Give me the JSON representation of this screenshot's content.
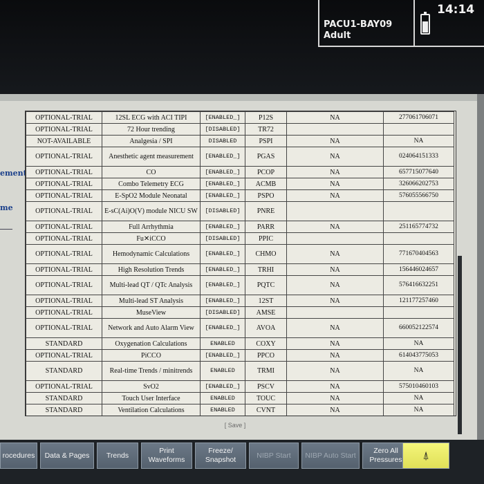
{
  "header": {
    "bed_label": "PACU1-BAY09",
    "patient_category": "Adult",
    "clock": "14:14",
    "battery_icon": "battery-icon"
  },
  "left_fragments": [
    "ement",
    "me"
  ],
  "options_table": {
    "rows": [
      [
        "OPTIONAL-TRIAL",
        "12SL ECG with ACI TIPI",
        "[ENABLED_]",
        "P12S",
        "NA",
        "277061706071"
      ],
      [
        "OPTIONAL-TRIAL",
        "72 Hour trending",
        "[DISABLED]",
        "TR72",
        "",
        ""
      ],
      [
        "NOT-AVAILABLE",
        "Analgesia / SPI",
        "DISABLED",
        "PSPI",
        "NA",
        "NA"
      ],
      [
        "OPTIONAL-TRIAL",
        "Anesthetic agent measurement",
        "[ENABLED_]",
        "PGAS",
        "NA",
        "024064151333"
      ],
      [
        "OPTIONAL-TRIAL",
        "CO",
        "[ENABLED_]",
        "PCOP",
        "NA",
        "657715077640"
      ],
      [
        "OPTIONAL-TRIAL",
        "Combo Telemetry ECG",
        "[ENABLED_]",
        "ACMB",
        "NA",
        "326066202753"
      ],
      [
        "OPTIONAL-TRIAL",
        "E-SpO2 Module Neonatal",
        "[ENABLED_]",
        "PSPO",
        "NA",
        "576055566750"
      ],
      [
        "OPTIONAL-TRIAL",
        "E-sC(Ai)O(V) module NICU SW",
        "[DISABLED]",
        "PNRE",
        "",
        ""
      ],
      [
        "OPTIONAL-TRIAL",
        "Full Arrhythmia",
        "[ENABLED_]",
        "PARR",
        "NA",
        "251165774732"
      ],
      [
        "OPTIONAL-TRIAL",
        "Fu✕iCCO",
        "[DISABLED]",
        "PPIC",
        "",
        ""
      ],
      [
        "OPTIONAL-TRIAL",
        "Hemodynamic Calculations",
        "[ENABLED_]",
        "CHMO",
        "NA",
        "771670404563"
      ],
      [
        "OPTIONAL-TRIAL",
        "High Resolution Trends",
        "[ENABLED_]",
        "TRHI",
        "NA",
        "156446024657"
      ],
      [
        "OPTIONAL-TRIAL",
        "Multi-lead QT / QTc Analysis",
        "[ENABLED_]",
        "PQTC",
        "NA",
        "576416632251"
      ],
      [
        "OPTIONAL-TRIAL",
        "Multi-lead ST Analysis",
        "[ENABLED_]",
        "12ST",
        "NA",
        "121177257460"
      ],
      [
        "OPTIONAL-TRIAL",
        "MuseView",
        "[DISABLED]",
        "AMSE",
        "",
        ""
      ],
      [
        "OPTIONAL-TRIAL",
        "Network and Auto Alarm View",
        "[ENABLED_]",
        "AVOA",
        "NA",
        "660052122574"
      ],
      [
        "STANDARD",
        "Oxygenation Calculations",
        "ENABLED",
        "COXY",
        "NA",
        "NA"
      ],
      [
        "OPTIONAL-TRIAL",
        "PiCCO",
        "[ENABLED_]",
        "PPCO",
        "NA",
        "614043775053"
      ],
      [
        "STANDARD",
        "Real-time Trends / minitrends",
        "ENABLED",
        "TRMI",
        "NA",
        "NA"
      ],
      [
        "OPTIONAL-TRIAL",
        "SvO2",
        "[ENABLED_]",
        "PSCV",
        "NA",
        "575010460103"
      ],
      [
        "STANDARD",
        "Touch User Interface",
        "ENABLED",
        "TOUC",
        "NA",
        "NA"
      ],
      [
        "STANDARD",
        "Ventilation Calculations",
        "ENABLED",
        "CVNT",
        "NA",
        "NA"
      ]
    ]
  },
  "save_label": "[ Save ]",
  "softkeys": [
    {
      "label": "rocedures",
      "enabled": true
    },
    {
      "label": "Data & Pages",
      "enabled": true
    },
    {
      "label": "Trends",
      "enabled": true
    },
    {
      "label": "Print Waveforms",
      "enabled": true
    },
    {
      "label": "Freeze/ Snapshot",
      "enabled": true
    },
    {
      "label": "NIBP Start",
      "enabled": false
    },
    {
      "label": "NIBP Auto Start",
      "enabled": false
    },
    {
      "label": "Zero All Pressures",
      "enabled": true
    },
    {
      "label": "⍋",
      "icon": "alarm-bell-icon",
      "enabled": true
    }
  ],
  "colors": {
    "softkey": "#5f6b78",
    "alarm_key": "#ecec6a",
    "table_bg": "#ecebe3"
  }
}
